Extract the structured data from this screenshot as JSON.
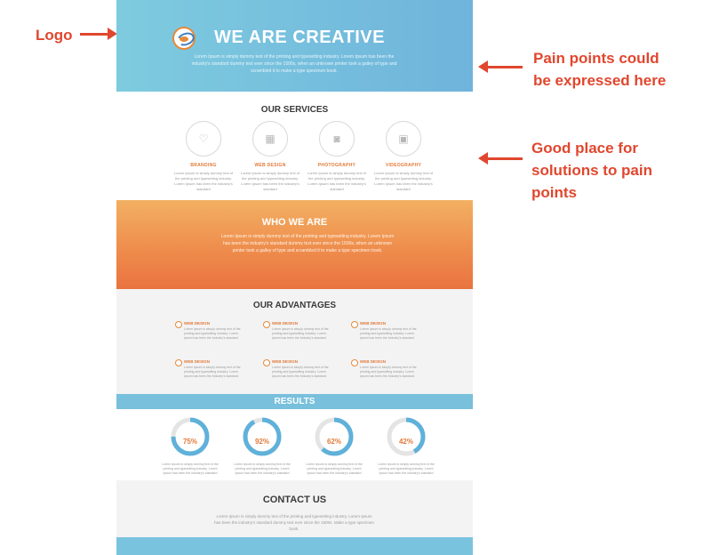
{
  "annotations": {
    "logo": "Logo",
    "pain_points": [
      "Pain points could",
      "be expressed here"
    ],
    "solutions": [
      "Good place for",
      "solutions to pain",
      "points"
    ],
    "color": "#e0472e"
  },
  "hero": {
    "title": "WE ARE CREATIVE",
    "text": "Lorem Ipsum is simply dummy text of the printing and typesetting industry. Lorem Ipsum has been the industry's standard dummy text ever since the 1500s, when an unknown printer took a galley of type and scrambled it to make a type specimen book."
  },
  "services": {
    "title": "OUR SERVICES",
    "items": [
      {
        "name": "BRANDING",
        "icon": "heart-icon",
        "text": "Lorem Ipsum is simply dummy text of the printing and typesetting industry. Lorem Ipsum has been the industry's standard"
      },
      {
        "name": "WEB DESIGN",
        "icon": "web-design-icon",
        "text": "Lorem Ipsum is simply dummy text of the printing and typesetting industry. Lorem Ipsum has been the industry's standard"
      },
      {
        "name": "PHOTOGRAPHY",
        "icon": "camera-icon",
        "text": "Lorem Ipsum is simply dummy text of the printing and typesetting industry. Lorem Ipsum has been the industry's standard"
      },
      {
        "name": "VIDEOGRAPHY",
        "icon": "video-icon",
        "text": "Lorem Ipsum is simply dummy text of the printing and typesetting industry. Lorem Ipsum has been the industry's standard"
      }
    ]
  },
  "who": {
    "title": "WHO WE ARE",
    "text": "Lorem Ipsum is simply dummy text of the printing and typesetting industry. Lorem Ipsum has been the industry's standard dummy text ever since the 1500s, when an unknown printer took a galley of type and scrambled it to make a type specimen book."
  },
  "advantages": {
    "title": "OUR ADVANTAGES",
    "items": [
      {
        "name": "WEB DESIGN",
        "text": "Lorem Ipsum is simply dummy text of the printing and typesetting industry. Lorem Ipsum has been the industry's standard"
      },
      {
        "name": "WEB DESIGN",
        "text": "Lorem Ipsum is simply dummy text of the printing and typesetting industry. Lorem Ipsum has been the industry's standard"
      },
      {
        "name": "WEB DESIGN",
        "text": "Lorem Ipsum is simply dummy text of the printing and typesetting industry. Lorem Ipsum has been the industry's standard"
      },
      {
        "name": "WEB DESIGN",
        "text": "Lorem Ipsum is simply dummy text of the printing and typesetting industry. Lorem Ipsum has been the industry's standard"
      },
      {
        "name": "WEB DESIGN",
        "text": "Lorem Ipsum is simply dummy text of the printing and typesetting industry. Lorem Ipsum has been the industry's standard"
      },
      {
        "name": "WEB DESIGN",
        "text": "Lorem Ipsum is simply dummy text of the printing and typesetting industry. Lorem Ipsum has been the industry's standard"
      }
    ]
  },
  "results": {
    "title": "RESULTS",
    "items": [
      {
        "value": "75%",
        "percent": 75,
        "text": "Lorem Ipsum is simply dummy text of the printing and typesetting industry. Lorem Ipsum has been the industry's standard"
      },
      {
        "value": "92%",
        "percent": 92,
        "text": "Lorem Ipsum is simply dummy text of the printing and typesetting industry. Lorem Ipsum has been the industry's standard"
      },
      {
        "value": "62%",
        "percent": 62,
        "text": "Lorem Ipsum is simply dummy text of the printing and typesetting industry. Lorem Ipsum has been the industry's standard"
      },
      {
        "value": "42%",
        "percent": 42,
        "text": "Lorem Ipsum is simply dummy text of the printing and typesetting industry. Lorem Ipsum has been the industry's standard"
      }
    ]
  },
  "contact": {
    "title": "CONTACT US",
    "text": "Lorem Ipsum is simply dummy text of the printing and typesetting industry. Lorem Ipsum has been the industry's standard dummy text ever since the 1500s. Make a type specimen book."
  },
  "colors": {
    "hero_blue": "#74bfdd",
    "accent_orange": "#e07a38",
    "ring_blue": "#5fb1da"
  }
}
